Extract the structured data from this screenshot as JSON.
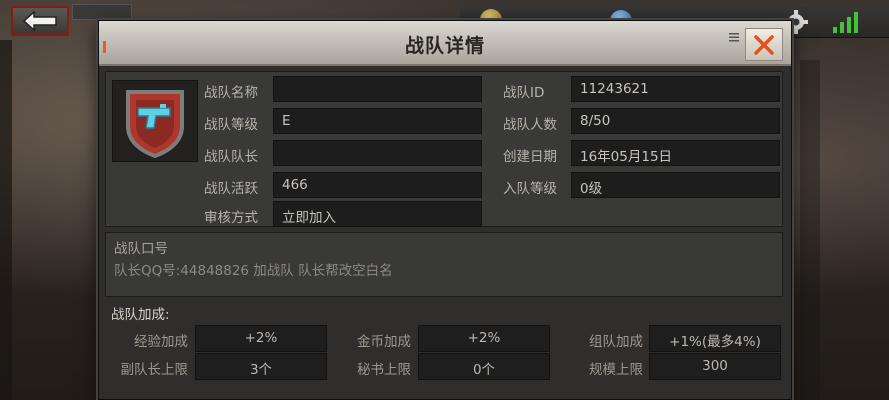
{
  "dialog": {
    "title": "战队详情"
  },
  "team_info": {
    "name_label": "战队名称",
    "name_value": "",
    "level_label": "战队等级",
    "level_value": "E",
    "leader_label": "战队队长",
    "leader_value": "",
    "activity_label": "战队活跃",
    "activity_value": "466",
    "review_label": "审核方式",
    "review_value": "立即加入",
    "id_label": "战队ID",
    "id_value": "11243621",
    "members_label": "战队人数",
    "members_value": "8/50",
    "created_label": "创建日期",
    "created_value": "16年05月15日",
    "join_level_label": "入队等级",
    "join_level_value": "0级"
  },
  "slogan": {
    "label": "战队口号",
    "text": "队长QQ号:44848826    加战队 队长帮改空白名"
  },
  "bonus": {
    "title": "战队加成:",
    "exp_label": "经验加成",
    "exp_value": "+2%",
    "gold_label": "金币加成",
    "gold_value": "+2%",
    "squad_label": "组队加成",
    "squad_value": "+1%(最多4%)",
    "vice_label": "副队长上限",
    "vice_value": "3个",
    "secretary_label": "秘书上限",
    "secretary_value": "0个",
    "scale_label": "规模上限",
    "scale_value": "300"
  },
  "colors": {
    "close_x": "#e0541c",
    "signal": "#46c13c",
    "emblem_red": "#b0362a",
    "emblem_gun": "#5fd0e8"
  }
}
